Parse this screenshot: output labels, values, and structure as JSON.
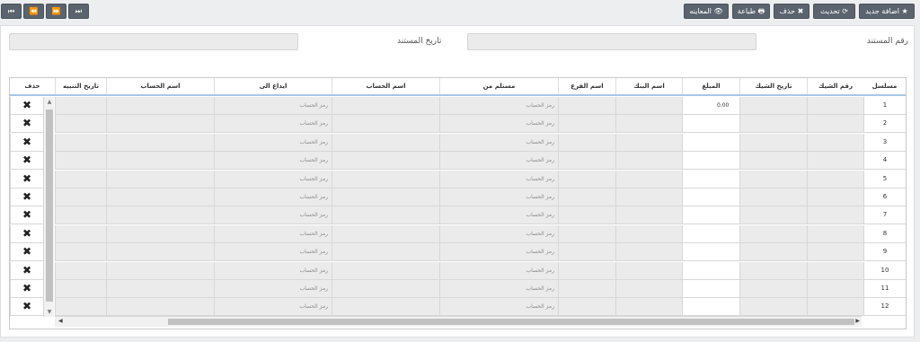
{
  "toolbar": {
    "nav": [
      "⏮",
      "⏪",
      "⏩",
      "⏭"
    ],
    "add_new": "اضافة جديد",
    "refresh": "تحديث",
    "delete": "حذف",
    "print": "طباعة",
    "preview": "المعاينه"
  },
  "form": {
    "doc_number_label": "رقم المستند",
    "doc_date_label": "تاريخ المستند"
  },
  "table": {
    "headers": {
      "serial": "مسلسل",
      "check_number": "رقم الشيك",
      "check_date": "تاريخ الشيك",
      "amount": "المبلغ",
      "bank_name": "اسم البنك",
      "branch_name": "اسم الفرع",
      "received_from": "مستلم من",
      "account_name": "اسم الحساب",
      "deposit_to": "ايداع الى",
      "account_name_2": "اسم الحساب",
      "due_date": "تاريخ التنبيه",
      "delete": "حذف"
    },
    "account_placeholder": "رمز الحساب",
    "rows": [
      {
        "serial": "1",
        "amount": "0.00"
      },
      {
        "serial": "2",
        "amount": ""
      },
      {
        "serial": "3",
        "amount": ""
      },
      {
        "serial": "4",
        "amount": ""
      },
      {
        "serial": "5",
        "amount": ""
      },
      {
        "serial": "6",
        "amount": ""
      },
      {
        "serial": "7",
        "amount": ""
      },
      {
        "serial": "8",
        "amount": ""
      },
      {
        "serial": "9",
        "amount": ""
      },
      {
        "serial": "10",
        "amount": ""
      },
      {
        "serial": "11",
        "amount": ""
      },
      {
        "serial": "12",
        "amount": ""
      }
    ]
  },
  "colors": {
    "button_bg": "#5b646e",
    "header_border": "#a9c6e8",
    "cell_bg": "#ebebeb"
  }
}
